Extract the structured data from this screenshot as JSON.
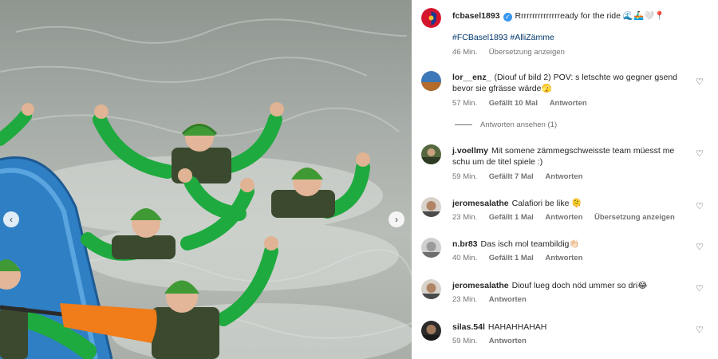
{
  "post": {
    "author": "fcbasel1893",
    "caption": "Rrrrrrrrrrrrrrready for the ride 🌊🚣🏻‍♂️🤍📍",
    "hashtags": "#FCBasel1893 #AlliZämme",
    "time": "46 Min.",
    "translate_label": "Übersetzung anzeigen"
  },
  "comments": [
    {
      "user": "lor__enz_",
      "text": "(Diouf uf bild 2) POV: s letschte wo gegner gsend bevor sie gfrässe wärde🫣",
      "time": "57 Min.",
      "likes": "Gefällt 10 Mal",
      "reply_label": "Antworten",
      "view_replies": "Antworten ansehen (1)"
    },
    {
      "user": "j.voellmy",
      "text": "Mit somene zämmegschweisste team müesst me schu um de titel spiele :)",
      "time": "59 Min.",
      "likes": "Gefällt 7 Mal",
      "reply_label": "Antworten"
    },
    {
      "user": "jeromesalathe",
      "text": "Calafiori be like 🫠",
      "time": "23 Min.",
      "likes": "Gefällt 1 Mal",
      "reply_label": "Antworten",
      "translate_label": "Übersetzung anzeigen"
    },
    {
      "user": "n.br83",
      "text": "Das isch mol teambildig👏🏻",
      "time": "40 Min.",
      "likes": "Gefällt 1 Mal",
      "reply_label": "Antworten"
    },
    {
      "user": "jeromesalathe",
      "text": "Diouf lueg doch nöd ummer so dri😂",
      "time": "23 Min.",
      "reply_label": "Antworten"
    },
    {
      "user": "silas.54l",
      "text": "HAHAHHAHAH",
      "time": "59 Min.",
      "reply_label": "Antworten"
    }
  ],
  "icons": {
    "heart": "heart-outline-icon",
    "verified": "verified-badge-icon",
    "prev": "chevron-left-icon",
    "next": "chevron-right-icon"
  },
  "colors": {
    "helmet": "#3f9a35",
    "wetsuit": "#1faa3f",
    "raft": "#2f7fc4",
    "paddle": "#f07c1a",
    "hashtag": "#00376b",
    "meta": "#737373"
  }
}
